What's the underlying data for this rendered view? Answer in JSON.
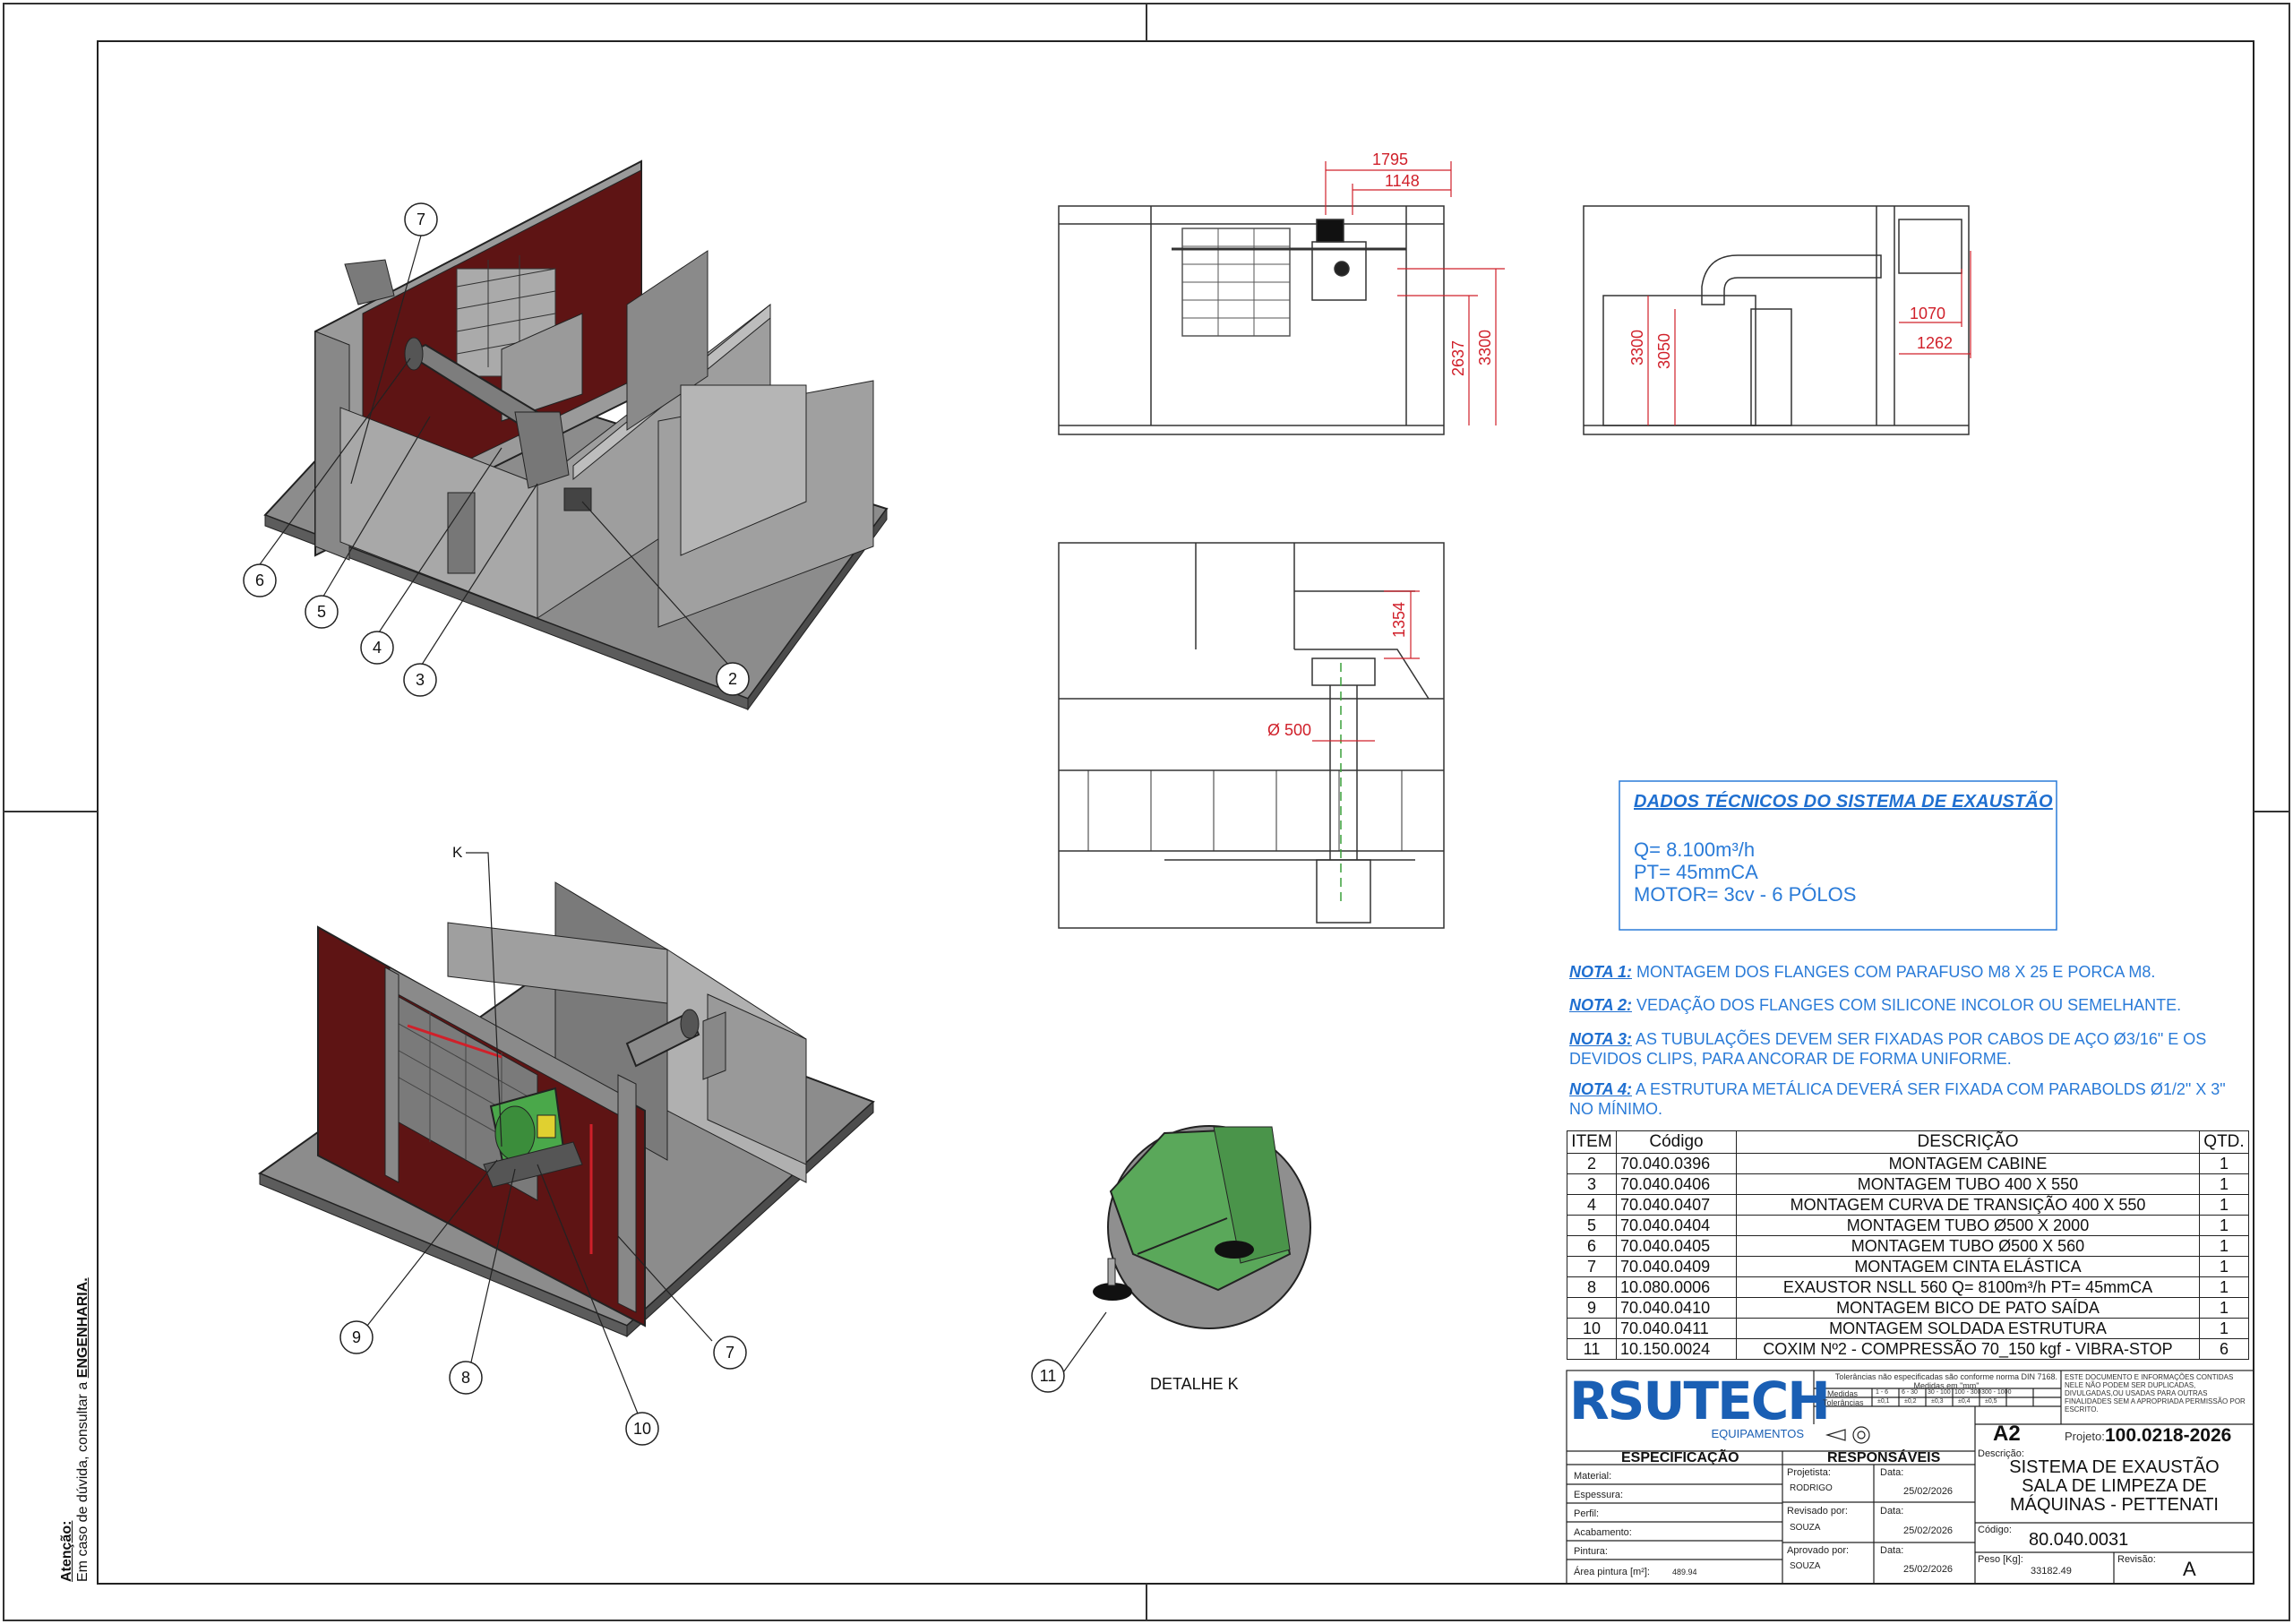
{
  "side_note": {
    "title": "Atenção:",
    "text": "Em caso de dúvida, consultar a",
    "emph": "ENGENHARIA."
  },
  "balloons_top": [
    "7",
    "6",
    "5",
    "4",
    "3",
    "2"
  ],
  "balloons_bottom": [
    "K",
    "9",
    "8",
    "10",
    "7"
  ],
  "balloon_detail": "11",
  "detail_label": "DETALHE K",
  "dims": {
    "front": [
      "1795",
      "1148",
      "2637",
      "3300"
    ],
    "side": [
      "3300",
      "3050",
      "1070",
      "1262"
    ],
    "plan": [
      "1354",
      "Ø 500"
    ]
  },
  "dados": {
    "title": "DADOS TÉCNICOS DO SISTEMA DE EXAUSTÃO",
    "lines": [
      "Q= 8.100m³/h",
      "PT= 45mmCA",
      "MOTOR= 3cv - 6 PÓLOS"
    ]
  },
  "notas": [
    {
      "label": "NOTA 1:",
      "text": " MONTAGEM DOS FLANGES COM PARAFUSO M8 X 25 E PORCA M8."
    },
    {
      "label": "NOTA 2:",
      "text": " VEDAÇÃO DOS FLANGES COM SILICONE INCOLOR OU SEMELHANTE."
    },
    {
      "label": "NOTA 3:",
      "text": " AS TUBULAÇÕES DEVEM SER FIXADAS POR CABOS DE AÇO Ø3/16\" E OS DEVIDOS CLIPS, PARA ANCORAR DE FORMA UNIFORME."
    },
    {
      "label": "NOTA 4:",
      "text": " A ESTRUTURA METÁLICA DEVERÁ SER FIXADA COM PARABOLDS Ø1/2\" X 3\" NO MÍNIMO."
    }
  ],
  "bom": {
    "headers": [
      "ITEM",
      "Código",
      "DESCRIÇÃO",
      "QTD."
    ],
    "rows": [
      [
        "2",
        "70.040.0396",
        "MONTAGEM CABINE",
        "1"
      ],
      [
        "3",
        "70.040.0406",
        "MONTAGEM TUBO 400 X 550",
        "1"
      ],
      [
        "4",
        "70.040.0407",
        "MONTAGEM CURVA DE TRANSIÇÃO 400 X 550",
        "1"
      ],
      [
        "5",
        "70.040.0404",
        "MONTAGEM TUBO Ø500 X 2000",
        "1"
      ],
      [
        "6",
        "70.040.0405",
        "MONTAGEM TUBO Ø500 X 560",
        "1"
      ],
      [
        "7",
        "70.040.0409",
        "MONTAGEM CINTA ELÁSTICA",
        "1"
      ],
      [
        "8",
        "10.080.0006",
        "EXAUSTOR NSLL 560 Q= 8100m³/h PT= 45mmCA",
        "1"
      ],
      [
        "9",
        "70.040.0410",
        "MONTAGEM BICO DE PATO SAÍDA",
        "1"
      ],
      [
        "10",
        "70.040.0411",
        "MONTAGEM SOLDADA ESTRUTURA",
        "1"
      ],
      [
        "11",
        "10.150.0024",
        "COXIM Nº2 - COMPRESSÃO 70_150 kgf - VIBRA-STOP",
        "6"
      ]
    ]
  },
  "title_block": {
    "logo": "RSUTECH",
    "logo_sub": "EQUIPAMENTOS",
    "tol_note": "Tolerâncias não especificadas são conforme norma DIN 7168. Medidas em \"mm\"",
    "tol_row1_label": "Medidas",
    "tol_row1": [
      "1 - 6",
      "6 - 30",
      "30 - 100",
      "100 - 300",
      "300 - 1000"
    ],
    "tol_row2_label": "Tolerâncias",
    "tol_row2": [
      "±0,1",
      "±0,2",
      "±0,3",
      "±0,4",
      "±0,5"
    ],
    "notice": "ESTE DOCUMENTO E INFORMAÇÕES CONTIDAS NELE NÃO PODEM SER DUPLICADAS, DIVULGADAS,OU USADAS PARA OUTRAS FINALIDADES SEM A APROPRIADA PERMISSÃO POR ESCRITO.",
    "sheet": "A2",
    "projeto_label": "Projeto:",
    "projeto": "100.0218-2026",
    "espec_header": "ESPECIFICAÇÃO",
    "resp_header": "RESPONSÁVEIS",
    "espec_rows": [
      "Material:",
      "Espessura:",
      "Perfil:",
      "Acabamento:",
      "Pintura:",
      "Área pintura [m²]:"
    ],
    "area_value": "489.94",
    "projetista_label": "Projetista:",
    "projetista": "RODRIGO",
    "revisado_label": "Revisado por:",
    "revisado": "SOUZA",
    "aprovado_label": "Aprovado por:",
    "aprovado": "SOUZA",
    "data_label": "Data:",
    "dates": [
      "25/02/2026",
      "25/02/2026",
      "25/02/2026"
    ],
    "descricao_label": "Descrição:",
    "descricao": [
      "SISTEMA DE EXAUSTÃO",
      "SALA DE LIMPEZA DE",
      "MÁQUINAS - PETTENATI"
    ],
    "codigo_label": "Código:",
    "codigo": "80.040.0031",
    "peso_label": "Peso [Kg]:",
    "peso": "33182.49",
    "revisao_label": "Revisão:",
    "revisao": "A"
  },
  "colors": {
    "dim": "#d0202a",
    "note_blue": "#2a7bd8",
    "wall_red": "#5e1414",
    "fan_green": "#4aa84a"
  }
}
